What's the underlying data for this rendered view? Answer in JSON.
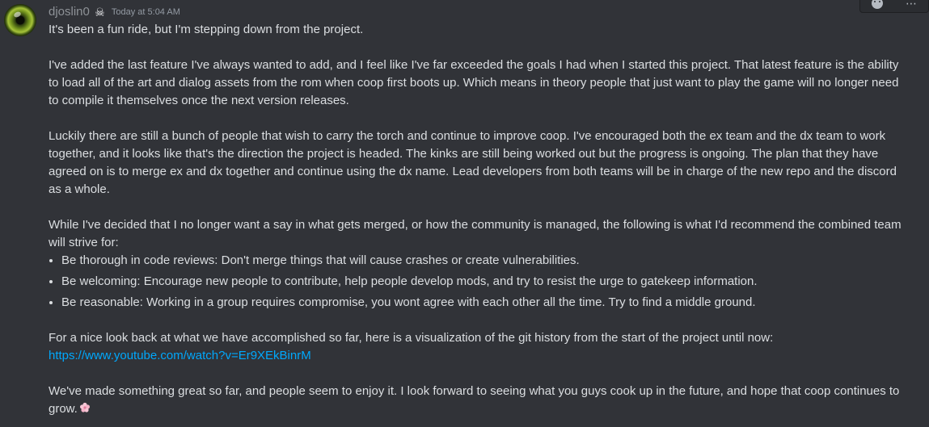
{
  "message": {
    "author": "djoslin0",
    "author_badge_icon": "skull-icon",
    "timestamp": "Today at 5:04 AM",
    "paragraphs": {
      "p1": "It's been a fun ride, but I'm stepping down from the project.",
      "p2": "I've added the last feature I've always wanted to add, and I feel like I've far exceeded the goals I had when I started this project. That latest feature is the ability to load all of the art and dialog assets from the rom when coop first boots up. Which means in theory people that just want to play the game will no longer need to compile it themselves once the next version releases.",
      "p3": "Luckily there are still a bunch of people that wish to carry the torch and continue to improve coop. I've encouraged both the ex team and the dx team to work together, and it looks like that's the direction the project is headed. The kinks are still being worked out but the progress is ongoing. The plan that they have agreed on is to merge ex and dx together and continue using the dx name. Lead developers from both teams will be in charge of the new repo and the discord as a whole.",
      "p4": "While I've decided that I no longer want a say in what gets merged, or how the community is managed, the following is what I'd recommend the combined team will strive for:",
      "p5": "For a nice look back at what we have accomplished so far, here is a visualization of the git history from the start of the project until now:",
      "p6": "We've made something great so far, and people seem to enjoy it. I look forward to seeing what you guys cook up in the future, and hope that coop continues to grow."
    },
    "bullets": [
      "Be thorough in code reviews: Don't merge things that will cause crashes or create vulnerabilities.",
      "Be welcoming: Encourage new people to contribute, help people develop mods, and try to resist the urge to gatekeep information.",
      "Be reasonable: Working in a group requires compromise, you wont agree with each other all the time. Try to find a middle ground."
    ],
    "link": "https://www.youtube.com/watch?v=Er9XEkBinrM",
    "ending_emoji": "cherry-blossom-icon"
  },
  "toolbar": {
    "reaction_icon": "add-reaction-icon",
    "more_label": "⋯"
  },
  "colors": {
    "background": "#313338",
    "text": "#dbdee1",
    "muted": "#949ba4",
    "link": "#00a8fc"
  }
}
